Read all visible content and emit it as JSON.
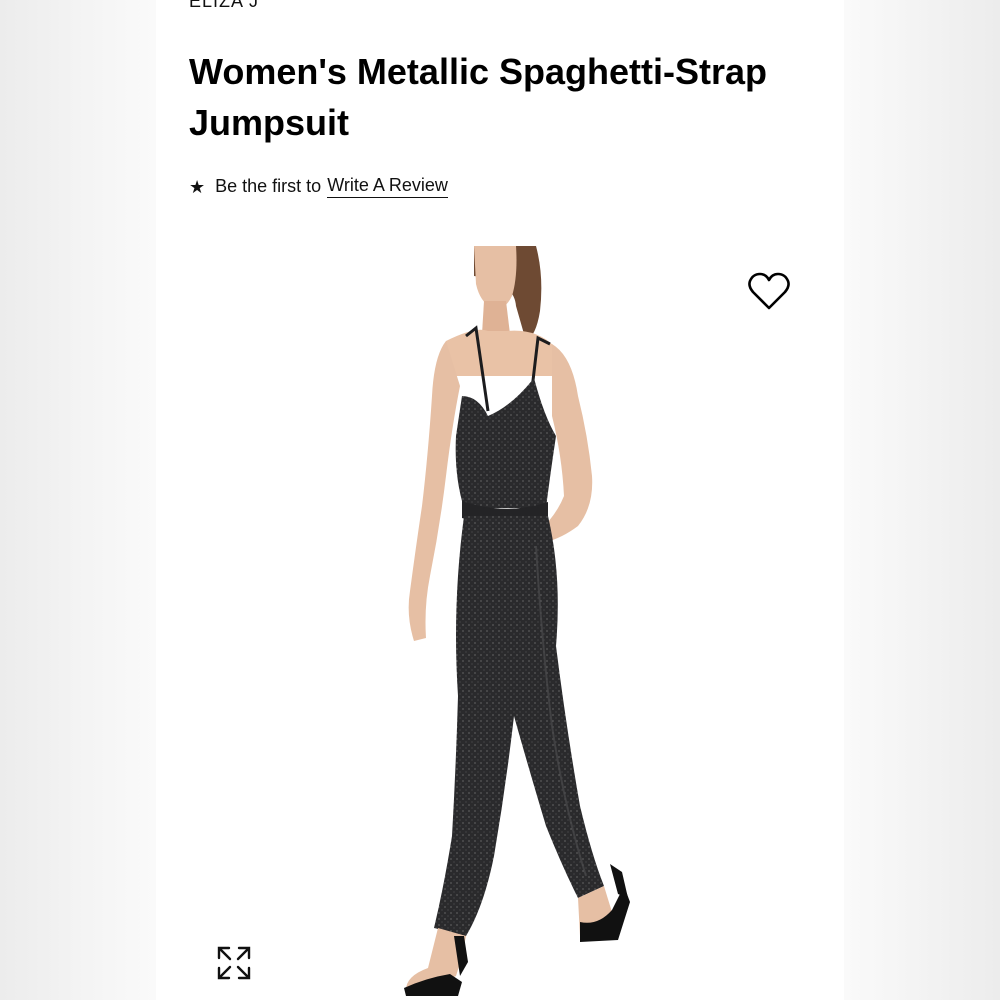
{
  "product": {
    "brand": "ELIZA J",
    "title": "Women's Metallic Spaghetti-Strap Jumpsuit"
  },
  "reviews": {
    "star_icon": "star-icon",
    "prefix": "Be the first to",
    "link_label": "Write A Review"
  },
  "media": {
    "image_subject": "model-wearing-jumpsuit",
    "wishlist_icon": "heart-icon",
    "expand_icon": "expand-arrows-icon"
  },
  "colors": {
    "text": "#000000",
    "garment": "#2b2b2d",
    "skin": "#e9c2a6",
    "hair": "#6e4a33"
  }
}
